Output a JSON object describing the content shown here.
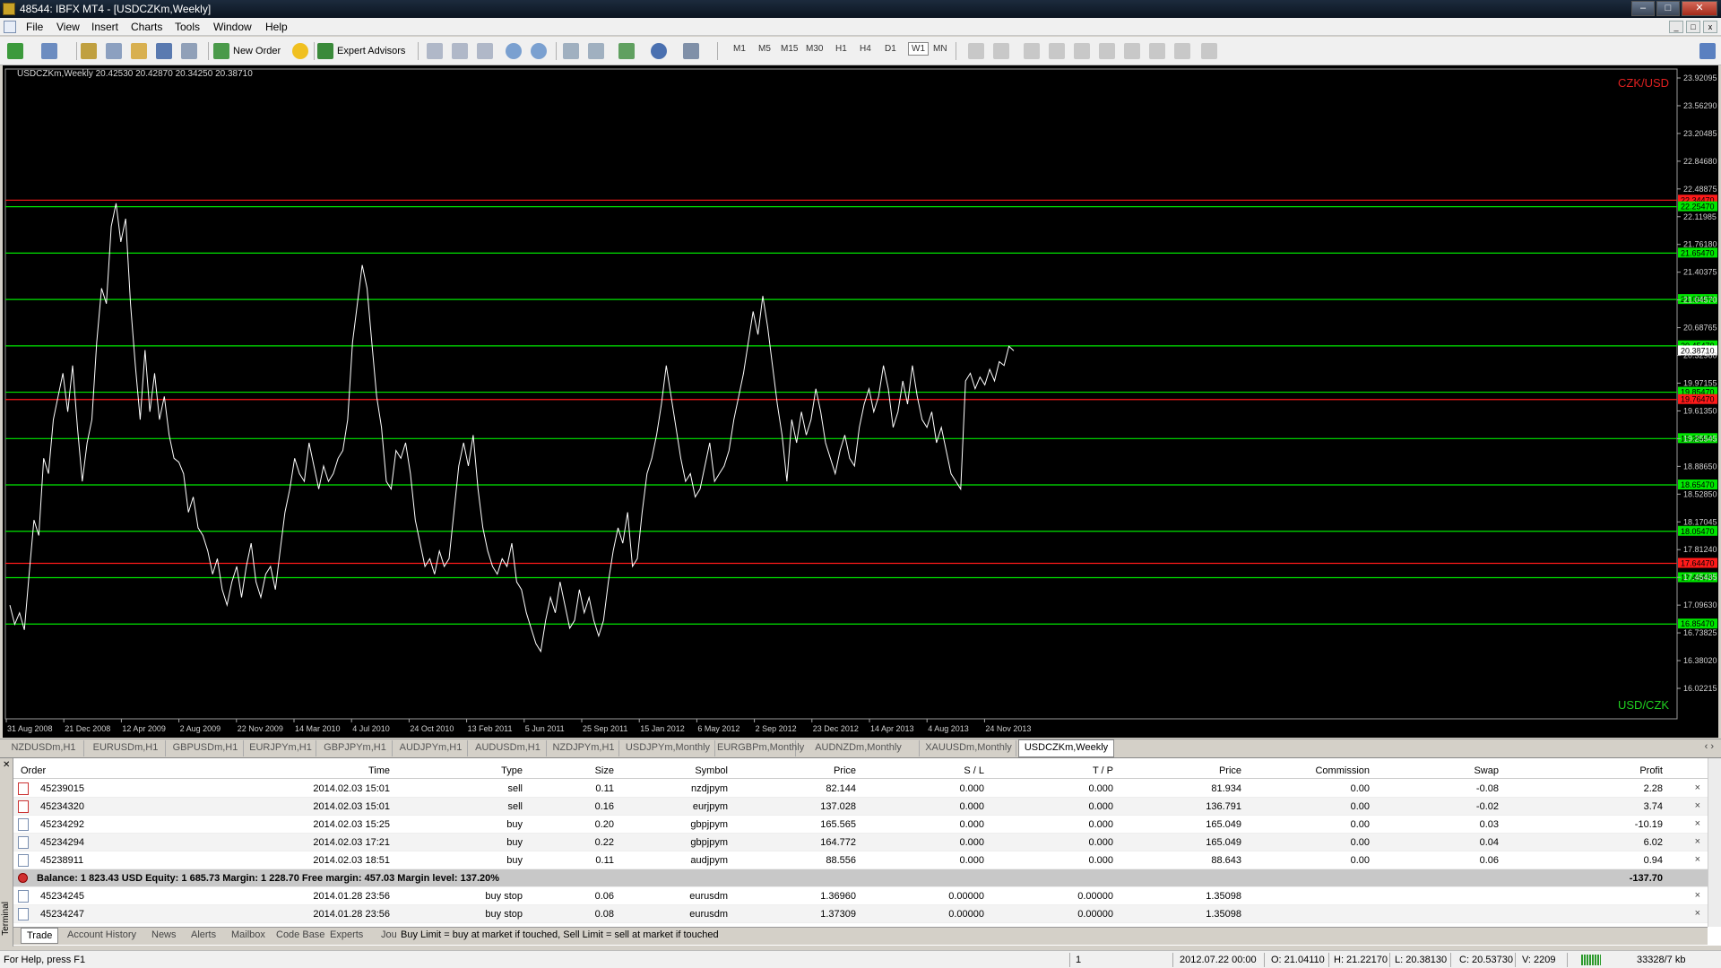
{
  "window": {
    "title": "48544: IBFX MT4 - [USDCZKm,Weekly]"
  },
  "menu": [
    "File",
    "View",
    "Insert",
    "Charts",
    "Tools",
    "Window",
    "Help"
  ],
  "toolbar": {
    "new_order": "New Order",
    "expert_advisors": "Expert Advisors",
    "timeframes": [
      "M1",
      "M5",
      "M15",
      "M30",
      "H1",
      "H4",
      "D1",
      "W1",
      "MN"
    ],
    "active_timeframe": "W1"
  },
  "chart": {
    "header": "USDCZKm,Weekly  20.42530 20.42870 20.34250 20.38710",
    "label_top": "CZK/USD",
    "label_bottom": "USD/CZK",
    "colors": {
      "background": "#000000",
      "price_line": "#ffffff",
      "green_level": "#00e600",
      "red_level": "#ff1a1a",
      "scale_text": "#d0d0d0"
    },
    "current_price_label": "20.38710"
  },
  "chart_data": {
    "type": "line",
    "ylim": [
      16.02215,
      23.92095
    ],
    "y_ticks": [
      "23.92095",
      "23.56290",
      "23.20485",
      "22.84680",
      "22.48875",
      "22.11985",
      "21.76180",
      "21.40375",
      "21.04570",
      "20.68765",
      "20.32960",
      "19.97155",
      "19.61350",
      "19.25545",
      "18.88650",
      "18.52850",
      "18.17045",
      "17.81240",
      "17.45435",
      "17.09630",
      "16.73825",
      "16.38020",
      "16.02215"
    ],
    "x_tick_labels": [
      "31 Aug 2008",
      "21 Dec 2008",
      "12 Apr 2009",
      "2 Aug 2009",
      "22 Nov 2009",
      "14 Mar 2010",
      "4 Jul 2010",
      "24 Oct 2010",
      "13 Feb 2011",
      "5 Jun 2011",
      "25 Sep 2011",
      "15 Jan 2012",
      "6 May 2012",
      "2 Sep 2012",
      "23 Dec 2012",
      "14 Apr 2013",
      "4 Aug 2013",
      "24 Nov 2013"
    ],
    "levels": [
      {
        "price": 22.34,
        "color": "red",
        "label": "22.34470"
      },
      {
        "price": 22.2547,
        "color": "green",
        "label": "22.25470"
      },
      {
        "price": 21.6547,
        "color": "green",
        "label": "21.65470"
      },
      {
        "price": 21.0547,
        "color": "green",
        "label": "21.05470"
      },
      {
        "price": 20.4547,
        "color": "green",
        "label": "20.45470"
      },
      {
        "price": 19.8547,
        "color": "green",
        "label": "19.85470"
      },
      {
        "price": 19.76,
        "color": "red",
        "label": "19.76470"
      },
      {
        "price": 19.2547,
        "color": "green",
        "label": "19.25470"
      },
      {
        "price": 18.6547,
        "color": "green",
        "label": "18.65470"
      },
      {
        "price": 18.0547,
        "color": "green",
        "label": "18.05470"
      },
      {
        "price": 17.64,
        "color": "red",
        "label": "17.64470"
      },
      {
        "price": 17.4547,
        "color": "green",
        "label": "17.45470"
      },
      {
        "price": 16.8547,
        "color": "green",
        "label": "16.85470"
      }
    ],
    "series": [
      {
        "values": [
          17.1,
          16.85,
          17.0,
          16.78,
          17.5,
          18.2,
          18.0,
          19.0,
          18.8,
          19.5,
          19.8,
          20.1,
          19.6,
          20.2,
          19.4,
          18.7,
          19.2,
          19.5,
          20.5,
          21.2,
          21.0,
          22.0,
          22.3,
          21.8,
          22.1,
          21.0,
          20.2,
          19.5,
          20.4,
          19.6,
          20.1,
          19.5,
          19.8,
          19.3,
          19.0,
          18.95,
          18.8,
          18.3,
          18.5,
          18.1,
          18.0,
          17.8,
          17.5,
          17.7,
          17.3,
          17.1,
          17.4,
          17.6,
          17.2,
          17.6,
          17.9,
          17.4,
          17.2,
          17.5,
          17.6,
          17.3,
          17.8,
          18.3,
          18.6,
          19.0,
          18.8,
          18.7,
          19.2,
          18.9,
          18.6,
          18.9,
          18.7,
          18.8,
          19.0,
          19.1,
          19.5,
          20.5,
          21.0,
          21.5,
          21.2,
          20.5,
          19.8,
          19.4,
          18.7,
          18.6,
          19.1,
          19.0,
          19.2,
          18.8,
          18.2,
          17.9,
          17.6,
          17.7,
          17.5,
          17.8,
          17.6,
          17.7,
          18.3,
          18.9,
          19.2,
          18.9,
          19.3,
          18.6,
          18.1,
          17.8,
          17.6,
          17.5,
          17.7,
          17.6,
          17.9,
          17.4,
          17.3,
          17.0,
          16.8,
          16.6,
          16.5,
          16.9,
          17.2,
          17.0,
          17.4,
          17.1,
          16.8,
          16.9,
          17.3,
          17.0,
          17.2,
          16.9,
          16.7,
          16.9,
          17.4,
          17.8,
          18.1,
          17.9,
          18.3,
          17.6,
          17.7,
          18.3,
          18.8,
          19.0,
          19.3,
          19.7,
          20.2,
          19.8,
          19.4,
          19.0,
          18.7,
          18.8,
          18.5,
          18.6,
          18.9,
          19.2,
          18.7,
          18.8,
          18.9,
          19.1,
          19.5,
          19.8,
          20.1,
          20.5,
          20.9,
          20.6,
          21.1,
          20.7,
          20.2,
          19.7,
          19.3,
          18.7,
          19.5,
          19.2,
          19.6,
          19.3,
          19.5,
          19.9,
          19.6,
          19.2,
          19.0,
          18.8,
          19.1,
          19.3,
          19.0,
          18.9,
          19.4,
          19.7,
          19.9,
          19.6,
          19.8,
          20.2,
          19.9,
          19.4,
          19.6,
          20.0,
          19.7,
          20.2,
          19.8,
          19.5,
          19.4,
          19.6,
          19.2,
          19.4,
          19.1,
          18.8,
          18.7,
          18.6,
          20.0,
          20.1,
          19.9,
          20.05,
          19.95,
          20.15,
          20.0,
          20.25,
          20.2,
          20.45,
          20.39
        ]
      }
    ]
  },
  "chart_tabs": [
    "NZDUSDm,H1",
    "EURUSDm,H1",
    "GBPUSDm,H1",
    "EURJPYm,H1",
    "GBPJPYm,H1",
    "AUDJPYm,H1",
    "AUDUSDm,H1",
    "NZDJPYm,H1",
    "USDJPYm,Monthly",
    "EURGBPm,Monthly",
    "AUDNZDm,Monthly",
    "XAUUSDm,Monthly",
    "USDCZKm,Weekly"
  ],
  "active_chart_tab": "USDCZKm,Weekly",
  "terminal": {
    "side_label": "Terminal",
    "columns": [
      "Order",
      "Time",
      "Type",
      "Size",
      "Symbol",
      "Price",
      "S / L",
      "T / P",
      "Price",
      "Commission",
      "Swap",
      "Profit"
    ],
    "rows": [
      {
        "order": "45239015",
        "time": "2014.02.03 15:01",
        "type": "sell",
        "size": "0.11",
        "symbol": "nzdjpym",
        "price": "82.144",
        "sl": "0.000",
        "tp": "0.000",
        "cur": "81.934",
        "commission": "0.00",
        "swap": "-0.08",
        "profit": "2.28"
      },
      {
        "order": "45234320",
        "time": "2014.02.03 15:01",
        "type": "sell",
        "size": "0.16",
        "symbol": "eurjpym",
        "price": "137.028",
        "sl": "0.000",
        "tp": "0.000",
        "cur": "136.791",
        "commission": "0.00",
        "swap": "-0.02",
        "profit": "3.74"
      },
      {
        "order": "45234292",
        "time": "2014.02.03 15:25",
        "type": "buy",
        "size": "0.20",
        "symbol": "gbpjpym",
        "price": "165.565",
        "sl": "0.000",
        "tp": "0.000",
        "cur": "165.049",
        "commission": "0.00",
        "swap": "0.03",
        "profit": "-10.19"
      },
      {
        "order": "45234294",
        "time": "2014.02.03 17:21",
        "type": "buy",
        "size": "0.22",
        "symbol": "gbpjpym",
        "price": "164.772",
        "sl": "0.000",
        "tp": "0.000",
        "cur": "165.049",
        "commission": "0.00",
        "swap": "0.04",
        "profit": "6.02"
      },
      {
        "order": "45238911",
        "time": "2014.02.03 18:51",
        "type": "buy",
        "size": "0.11",
        "symbol": "audjpym",
        "price": "88.556",
        "sl": "0.000",
        "tp": "0.000",
        "cur": "88.643",
        "commission": "0.00",
        "swap": "0.06",
        "profit": "0.94"
      }
    ],
    "balance": {
      "text": "Balance: 1 823.43 USD  Equity: 1 685.73  Margin: 1 228.70  Free margin: 457.03  Margin level: 137.20%",
      "profit": "-137.70"
    },
    "pending": [
      {
        "order": "45234245",
        "time": "2014.01.28 23:56",
        "type": "buy stop",
        "size": "0.06",
        "symbol": "eurusdm",
        "price": "1.36960",
        "sl": "0.00000",
        "tp": "0.00000",
        "cur": "1.35098"
      },
      {
        "order": "45234247",
        "time": "2014.01.28 23:56",
        "type": "buy stop",
        "size": "0.08",
        "symbol": "eurusdm",
        "price": "1.37309",
        "sl": "0.00000",
        "tp": "0.00000",
        "cur": "1.35098"
      }
    ],
    "tabs": [
      "Trade",
      "Account History",
      "News",
      "Alerts",
      "Mailbox",
      "Code Base",
      "Experts",
      "Jou"
    ],
    "active_tab": "Trade",
    "hint": "Buy Limit = buy at market if touched, Sell Limit = sell at market if touched"
  },
  "status": {
    "help": "For Help, press F1",
    "profile": "1",
    "time": "2012.07.22 00:00",
    "open": "O: 21.04110",
    "high": "H: 21.22170",
    "low": "L: 20.38130",
    "close": "C: 20.53730",
    "volume": "V: 2209",
    "traffic": "33328/7 kb"
  }
}
